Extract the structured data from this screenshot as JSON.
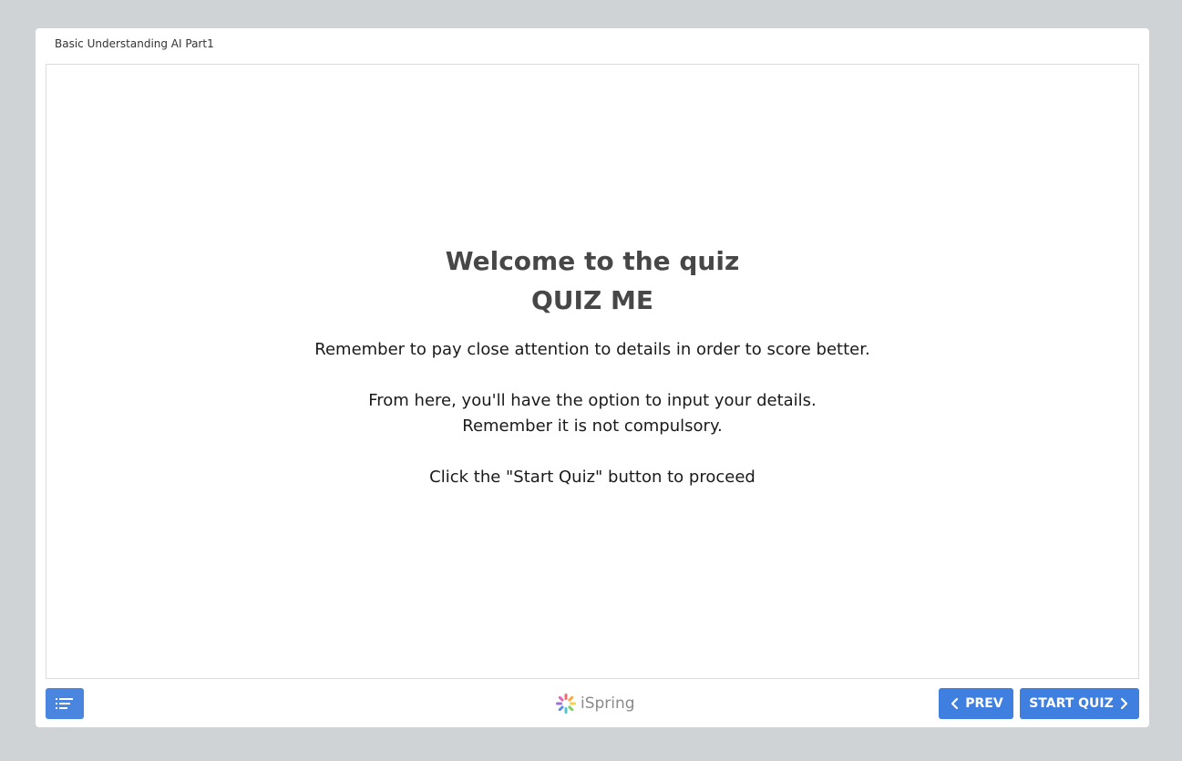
{
  "player": {
    "course_title": "Basic Understanding AI Part1"
  },
  "slide": {
    "heading_line1": "Welcome to the quiz",
    "heading_line2": "QUIZ ME",
    "paragraph1": "Remember to pay close attention to details in order to score better.",
    "paragraph2_line1": "From here, you'll have the option to input your details.",
    "paragraph2_line2": "Remember it is not compulsory.",
    "paragraph3": "Click the \"Start Quiz\" button to proceed"
  },
  "bottom_bar": {
    "menu_icon": "outline-list-icon",
    "logo_icon": "ispring-flower-icon",
    "logo_text": "iSpring",
    "prev_label": "PREV",
    "start_label": "START QUIZ"
  },
  "colors": {
    "accent": "#4a86e0",
    "background": "#d0d3d6",
    "heading": "#474747"
  }
}
